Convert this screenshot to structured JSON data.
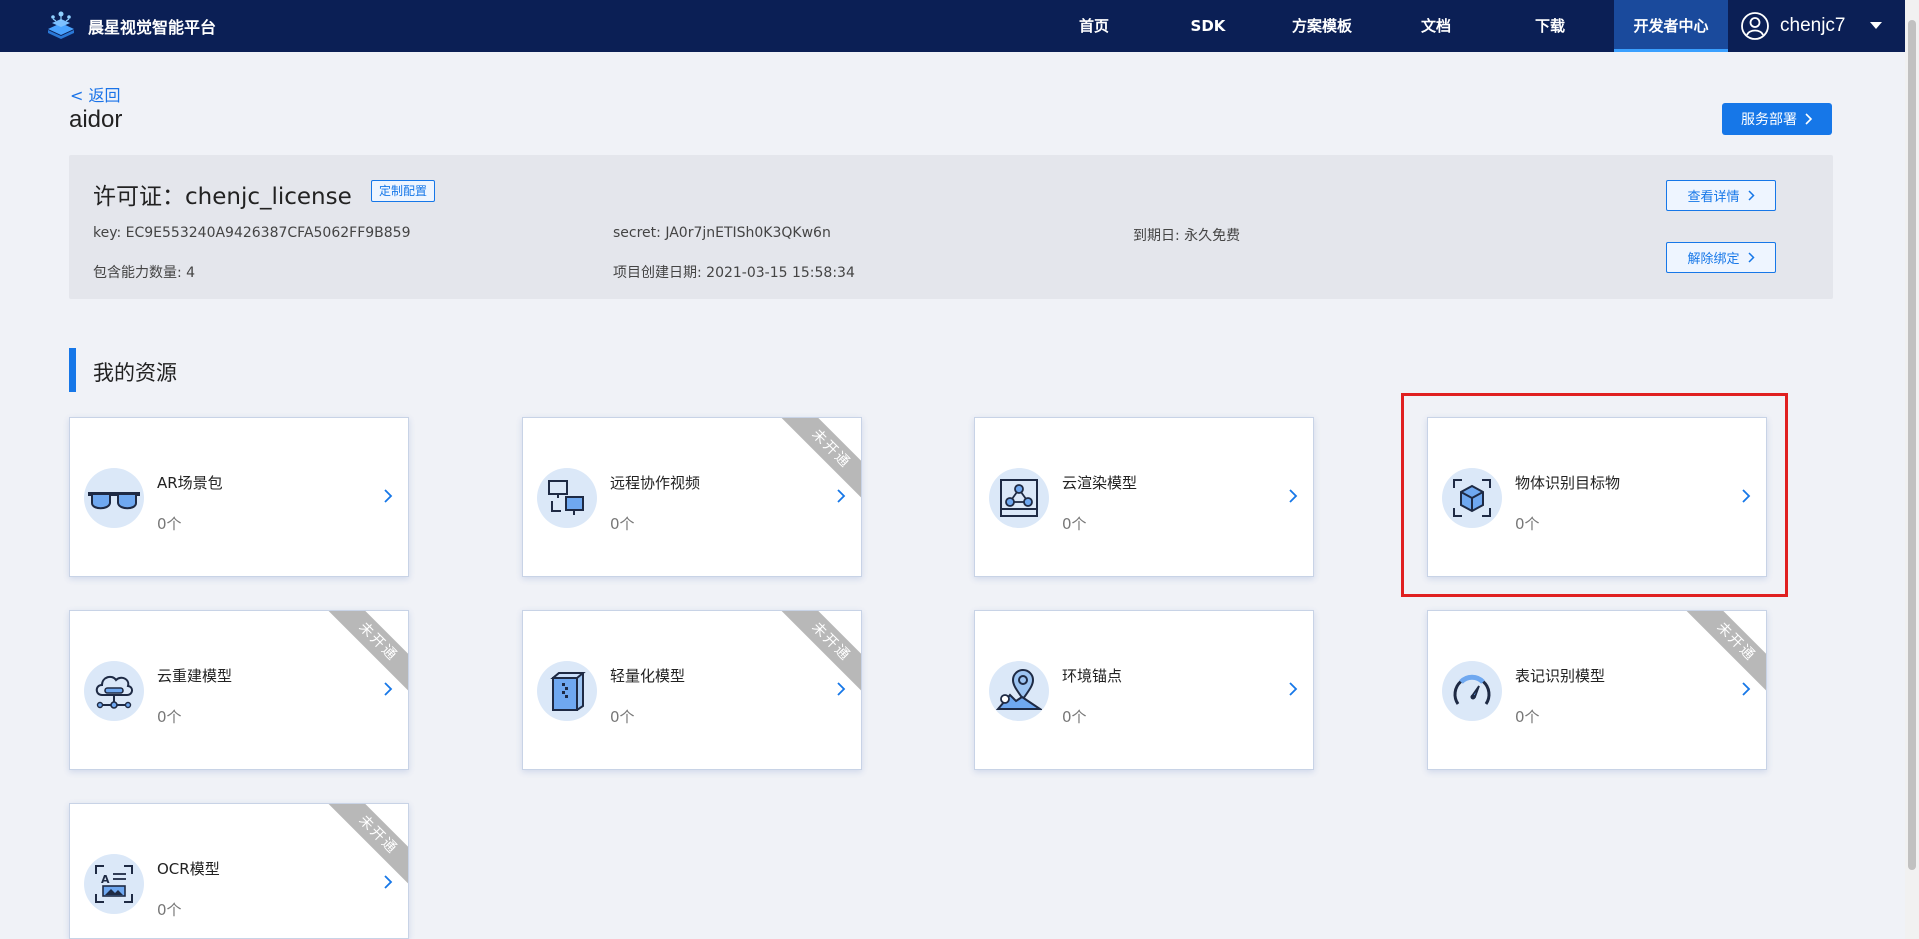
{
  "nav": {
    "brand": "晨星视觉智能平台",
    "items": [
      "首页",
      "SDK",
      "方案模板",
      "文档",
      "下载",
      "开发者中心"
    ],
    "active_index": 5,
    "user": "chenjc7"
  },
  "header": {
    "back": "< 返回",
    "project": "aidor",
    "deploy_button": "服务部署"
  },
  "license": {
    "title": "许可证：chenjc_license",
    "tag": "定制配置",
    "key": "key: EC9E553240A9426387CFA5062FF9B859",
    "secret": "secret: JA0r7jnETISh0K3QKw6n",
    "expire": "到期日: 永久免费",
    "ability_count": "包含能力数量: 4",
    "created": "项目创建日期: 2021-03-15 15:58:34",
    "details_button": "查看详情",
    "unbind_button": "解除绑定"
  },
  "section": {
    "title": "我的资源"
  },
  "cards": [
    {
      "title": "AR场景包",
      "count": "0个",
      "icon": "ar-glasses-icon",
      "ribbon": ""
    },
    {
      "title": "远程协作视频",
      "count": "0个",
      "icon": "remote-monitor-icon",
      "ribbon": "未开通"
    },
    {
      "title": "云渲染模型",
      "count": "0个",
      "icon": "cloud-render-icon",
      "ribbon": ""
    },
    {
      "title": "物体识别目标物",
      "count": "0个",
      "icon": "object-cube-icon",
      "ribbon": ""
    },
    {
      "title": "云重建模型",
      "count": "0个",
      "icon": "cloud-rebuild-icon",
      "ribbon": "未开通"
    },
    {
      "title": "轻量化模型",
      "count": "0个",
      "icon": "lightweight-box-icon",
      "ribbon": "未开通"
    },
    {
      "title": "环境锚点",
      "count": "0个",
      "icon": "anchor-pin-icon",
      "ribbon": ""
    },
    {
      "title": "表记识别模型",
      "count": "0个",
      "icon": "meter-gauge-icon",
      "ribbon": "未开通"
    },
    {
      "title": "OCR模型",
      "count": "0个",
      "icon": "ocr-scan-icon",
      "ribbon": "未开通"
    }
  ],
  "colors": {
    "nav_bg": "#0b1f55",
    "accent": "#1677e8",
    "highlight": "#e02020",
    "ribbon": "#b8b8b8"
  }
}
